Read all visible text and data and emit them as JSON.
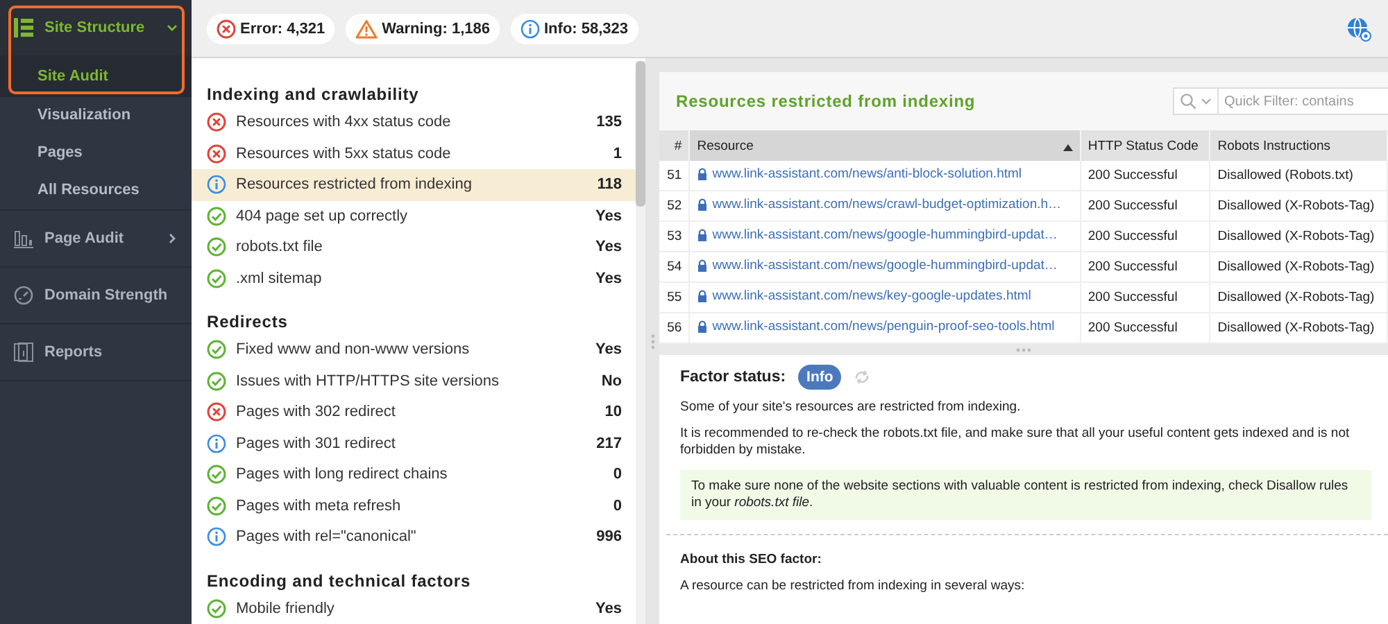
{
  "sidebar": {
    "items": [
      {
        "label": "Site Structure",
        "expanded": true,
        "selected": true,
        "highlighted": true,
        "children": [
          {
            "label": "Site Audit",
            "selected": true
          },
          {
            "label": "Visualization",
            "selected": false
          },
          {
            "label": "Pages",
            "selected": false
          },
          {
            "label": "All Resources",
            "selected": false
          }
        ]
      },
      {
        "label": "Page Audit",
        "expanded": false,
        "selected": false
      },
      {
        "label": "Domain Strength",
        "selected": false
      },
      {
        "label": "Reports",
        "selected": false
      }
    ]
  },
  "top_bar": {
    "counters": [
      {
        "kind": "error",
        "label": "Error: 4,321"
      },
      {
        "kind": "warning",
        "label": "Warning: 1,186"
      },
      {
        "kind": "info",
        "label": "Info: 58,323"
      }
    ]
  },
  "factors": {
    "sections": [
      {
        "title": "Indexing and crawlability",
        "rows": [
          {
            "kind": "error",
            "label": "Resources with 4xx status code",
            "value": "135",
            "selected": false
          },
          {
            "kind": "error",
            "label": "Resources with 5xx status code",
            "value": "1",
            "selected": false
          },
          {
            "kind": "info",
            "label": "Resources restricted from indexing",
            "value": "118",
            "selected": true
          },
          {
            "kind": "ok",
            "label": "404 page set up correctly",
            "value": "Yes",
            "selected": false
          },
          {
            "kind": "ok",
            "label": "robots.txt file",
            "value": "Yes",
            "selected": false
          },
          {
            "kind": "ok",
            "label": ".xml sitemap",
            "value": "Yes",
            "selected": false
          }
        ]
      },
      {
        "title": "Redirects",
        "rows": [
          {
            "kind": "ok",
            "label": "Fixed www and non-www versions",
            "value": "Yes",
            "selected": false
          },
          {
            "kind": "ok",
            "label": "Issues with HTTP/HTTPS site versions",
            "value": "No",
            "selected": false
          },
          {
            "kind": "error",
            "label": "Pages with 302 redirect",
            "value": "10",
            "selected": false
          },
          {
            "kind": "info",
            "label": "Pages with 301 redirect",
            "value": "217",
            "selected": false
          },
          {
            "kind": "ok",
            "label": "Pages with long redirect chains",
            "value": "0",
            "selected": false
          },
          {
            "kind": "ok",
            "label": "Pages with meta refresh",
            "value": "0",
            "selected": false
          },
          {
            "kind": "info",
            "label": "Pages with rel=\"canonical\"",
            "value": "996",
            "selected": false
          }
        ]
      },
      {
        "title": "Encoding and technical factors",
        "rows": [
          {
            "kind": "ok",
            "label": "Mobile friendly",
            "value": "Yes",
            "selected": false
          }
        ]
      }
    ]
  },
  "details": {
    "title": "Resources restricted from indexing",
    "filter": {
      "placeholder": "Quick Filter: contains"
    },
    "table": {
      "columns": [
        {
          "label": "#",
          "sorted": false
        },
        {
          "label": "Resource",
          "sorted": true
        },
        {
          "label": "HTTP Status Code",
          "sorted": false
        },
        {
          "label": "Robots Instructions",
          "sorted": false
        }
      ],
      "rows": [
        [
          "51",
          "www.link-assistant.com/news/anti-block-solution.html",
          "200 Successful",
          "Disallowed (Robots.txt)"
        ],
        [
          "52",
          "www.link-assistant.com/news/crawl-budget-optimization.h…",
          "200 Successful",
          "Disallowed (X-Robots-Tag)"
        ],
        [
          "53",
          "www.link-assistant.com/news/google-hummingbird-updat…",
          "200 Successful",
          "Disallowed (X-Robots-Tag)"
        ],
        [
          "54",
          "www.link-assistant.com/news/google-hummingbird-updat…",
          "200 Successful",
          "Disallowed (X-Robots-Tag)"
        ],
        [
          "55",
          "www.link-assistant.com/news/key-google-updates.html",
          "200 Successful",
          "Disallowed (X-Robots-Tag)"
        ],
        [
          "56",
          "www.link-assistant.com/news/penguin-proof-seo-tools.html",
          "200 Successful",
          "Disallowed (X-Robots-Tag)"
        ]
      ]
    },
    "factor_status": {
      "label": "Factor status:",
      "badge": {
        "kind": "info",
        "label": "Info"
      }
    },
    "paragraphs": [
      "Some of your site's resources are restricted from indexing.",
      "It is recommended to re-check the robots.txt file, and make sure that all your useful content gets indexed and is not forbidden by mistake."
    ],
    "tip": "To make sure none of the website sections with valuable content is restricted from indexing, check Disallow rules in your *robots.txt file*.",
    "about": {
      "title": "About this SEO factor:",
      "text": "A resource can be restricted from indexing in several ways:"
    }
  }
}
